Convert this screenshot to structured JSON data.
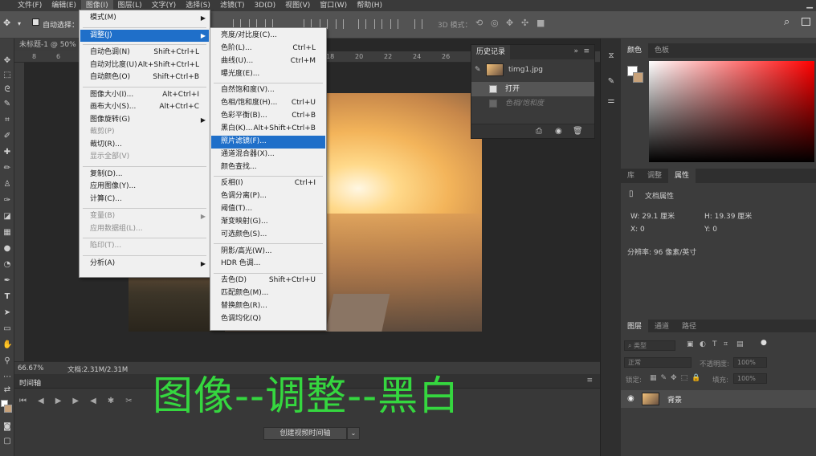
{
  "menubar": {
    "items": [
      "文件(F)",
      "编辑(E)",
      "图像(I)",
      "图层(L)",
      "文字(Y)",
      "选择(S)",
      "滤镜(T)",
      "3D(D)",
      "视图(V)",
      "窗口(W)",
      "帮助(H)"
    ],
    "active": "图像(I)"
  },
  "optbar": {
    "auto_select": "自动选择：",
    "mode_3d": "3D 模式："
  },
  "document": {
    "tab": "未标题-1 @ 50%",
    "zoom": "66.67%",
    "doc_size": "文档:2.31M/2.31M"
  },
  "ruler": [
    "8",
    "6",
    "18",
    "20",
    "22",
    "24",
    "26"
  ],
  "image_menu": [
    {
      "label": "模式(M)",
      "arrow": true
    },
    {
      "sep": true
    },
    {
      "label": "调整(J)",
      "arrow": true,
      "highlight": true
    },
    {
      "sep": true
    },
    {
      "label": "自动色调(N)",
      "shortcut": "Shift+Ctrl+L"
    },
    {
      "label": "自动对比度(U)",
      "shortcut": "Alt+Shift+Ctrl+L"
    },
    {
      "label": "自动颜色(O)",
      "shortcut": "Shift+Ctrl+B"
    },
    {
      "sep": true
    },
    {
      "label": "图像大小(I)...",
      "shortcut": "Alt+Ctrl+I"
    },
    {
      "label": "画布大小(S)...",
      "shortcut": "Alt+Ctrl+C"
    },
    {
      "label": "图像旋转(G)",
      "arrow": true
    },
    {
      "label": "裁剪(P)",
      "disabled": true
    },
    {
      "label": "裁切(R)..."
    },
    {
      "label": "显示全部(V)",
      "disabled": true
    },
    {
      "sep": true
    },
    {
      "label": "复制(D)..."
    },
    {
      "label": "应用图像(Y)..."
    },
    {
      "label": "计算(C)..."
    },
    {
      "sep": true
    },
    {
      "label": "变量(B)",
      "arrow": true,
      "disabled": true
    },
    {
      "label": "应用数据组(L)...",
      "disabled": true
    },
    {
      "sep": true
    },
    {
      "label": "陷印(T)...",
      "disabled": true
    },
    {
      "sep": true
    },
    {
      "label": "分析(A)",
      "arrow": true
    }
  ],
  "adjust_menu": [
    {
      "label": "亮度/对比度(C)..."
    },
    {
      "label": "色阶(L)...",
      "shortcut": "Ctrl+L"
    },
    {
      "label": "曲线(U)...",
      "shortcut": "Ctrl+M"
    },
    {
      "label": "曝光度(E)..."
    },
    {
      "sep": true
    },
    {
      "label": "自然饱和度(V)..."
    },
    {
      "label": "色相/饱和度(H)...",
      "shortcut": "Ctrl+U"
    },
    {
      "label": "色彩平衡(B)...",
      "shortcut": "Ctrl+B"
    },
    {
      "label": "黑白(K)...",
      "shortcut": "Alt+Shift+Ctrl+B"
    },
    {
      "label": "照片滤镜(F)...",
      "highlight": true
    },
    {
      "label": "通道混合器(X)..."
    },
    {
      "label": "颜色查找..."
    },
    {
      "sep": true
    },
    {
      "label": "反相(I)",
      "shortcut": "Ctrl+I"
    },
    {
      "label": "色调分离(P)..."
    },
    {
      "label": "阈值(T)..."
    },
    {
      "label": "渐变映射(G)..."
    },
    {
      "label": "可选颜色(S)..."
    },
    {
      "sep": true
    },
    {
      "label": "阴影/高光(W)..."
    },
    {
      "label": "HDR 色调..."
    },
    {
      "sep": true
    },
    {
      "label": "去色(D)",
      "shortcut": "Shift+Ctrl+U"
    },
    {
      "label": "匹配颜色(M)..."
    },
    {
      "label": "替换颜色(R)..."
    },
    {
      "label": "色调均化(Q)"
    }
  ],
  "history": {
    "title": "历史记录",
    "snapshot": "timg1.jpg",
    "steps": [
      {
        "label": "打开",
        "active": true
      },
      {
        "label": "色相/饱和度",
        "active": false
      }
    ]
  },
  "color_panel": {
    "tabs": [
      "颜色",
      "色板"
    ],
    "active": "颜色"
  },
  "props_panel": {
    "tabs": [
      "库",
      "调整",
      "属性"
    ],
    "active": "属性",
    "section": "文档属性",
    "w": "W: 29.1 厘米",
    "h": "H: 19.39 厘米",
    "x": "X: 0",
    "y": "Y: 0",
    "resolution": "分辨率: 96 像素/英寸"
  },
  "layers_panel": {
    "tabs": [
      "图层",
      "通道",
      "路径"
    ],
    "active": "图层",
    "search": "类型",
    "blend": "正常",
    "opacity_label": "不透明度:",
    "opacity": "100%",
    "lock_label": "锁定:",
    "fill_label": "填充:",
    "fill": "100%",
    "layers": [
      {
        "name": "背景"
      }
    ]
  },
  "timeline": {
    "title": "时间轴",
    "create_button": "创建视频时间轴"
  },
  "caption": "图像--调整--黑白"
}
